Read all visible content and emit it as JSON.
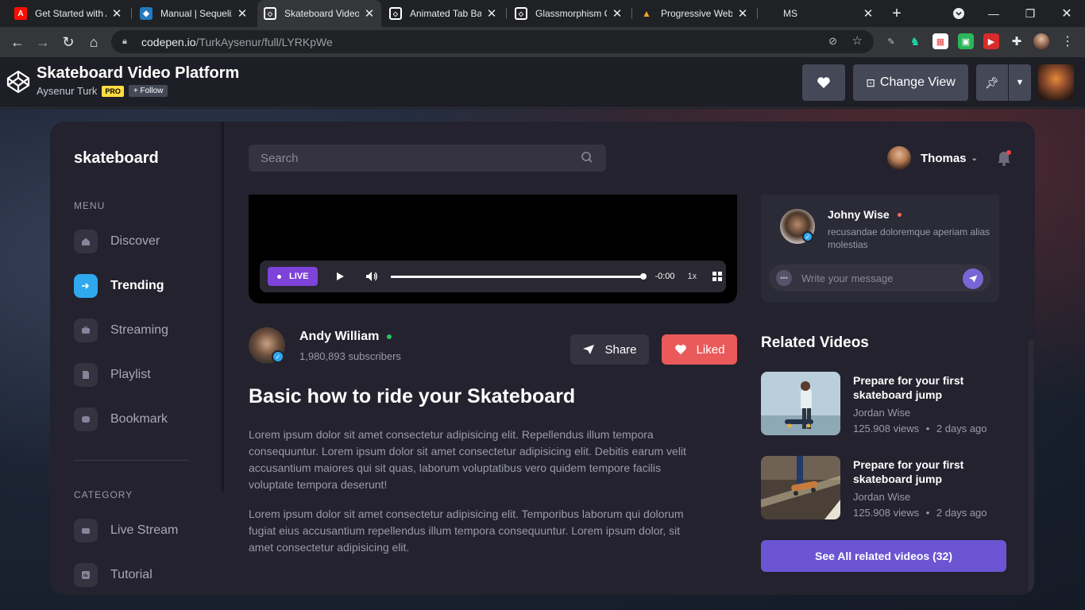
{
  "browser": {
    "tabs": [
      {
        "title": "Get Started with Adobe",
        "active": false
      },
      {
        "title": "Manual | Sequelize",
        "active": false
      },
      {
        "title": "Skateboard Video Platform",
        "active": true
      },
      {
        "title": "Animated Tab Bar",
        "active": false
      },
      {
        "title": "Glassmorphism Cards",
        "active": false
      },
      {
        "title": "Progressive Web App",
        "active": false
      },
      {
        "title": "MS",
        "active": false
      }
    ],
    "url_host": "codepen.io",
    "url_path": "/TurkAysenur/full/LYRKpWe"
  },
  "codepen": {
    "title": "Skateboard Video Platform",
    "author": "Aysenur Turk",
    "pro_label": "PRO",
    "follow_label": "+ Follow",
    "change_view_label": "Change View"
  },
  "app": {
    "brand": "skateboard",
    "menu_heading": "MENU",
    "menu": [
      {
        "label": "Discover",
        "icon": "home-icon",
        "active": false
      },
      {
        "label": "Trending",
        "icon": "trending-icon",
        "active": true
      },
      {
        "label": "Streaming",
        "icon": "streaming-icon",
        "active": false
      },
      {
        "label": "Playlist",
        "icon": "playlist-icon",
        "active": false
      },
      {
        "label": "Bookmark",
        "icon": "bookmark-icon",
        "active": false
      }
    ],
    "category_heading": "CATEGORY",
    "categories": [
      {
        "label": "Live Stream",
        "icon": "live-stream-icon"
      },
      {
        "label": "Tutorial",
        "icon": "tutorial-icon"
      }
    ],
    "search_placeholder": "Search",
    "user_name": "Thomas",
    "player": {
      "live_label": "LIVE",
      "time": "-0:00",
      "speed": "1x",
      "progress": 1.0
    },
    "channel": {
      "name": "Andy William",
      "subscribers": "1,980,893 subscribers"
    },
    "share_label": "Share",
    "liked_label": "Liked",
    "video_title": "Basic how to ride your Skateboard",
    "paragraphs": [
      "Lorem ipsum dolor sit amet consectetur adipisicing elit. Repellendus illum tempora consequuntur. Lorem ipsum dolor sit amet consectetur adipisicing elit. Debitis earum velit accusantium maiores qui sit quas, laborum voluptatibus vero quidem tempore facilis voluptate tempora deserunt!",
      "Lorem ipsum dolor sit amet consectetur adipisicing elit. Temporibus laborum qui dolorum fugiat eius accusantium repellendus illum tempora consequuntur. Lorem ipsum dolor, sit amet consectetur adipisicing elit."
    ],
    "chat": {
      "name": "Johny Wise",
      "message": "recusandae doloremque aperiam alias molestias",
      "input_placeholder": "Write your message"
    },
    "related_heading": "Related Videos",
    "related": [
      {
        "title": "Prepare for your first skateboard jump",
        "author": "Jordan Wise",
        "views": "125.908 views",
        "age": "2 days ago"
      },
      {
        "title": "Prepare for your first skateboard jump",
        "author": "Jordan Wise",
        "views": "125.908 views",
        "age": "2 days ago"
      }
    ],
    "see_all_label": "See All related videos (32)"
  },
  "colors": {
    "accent_blue": "#2ea8ef",
    "live_purple": "#7e43d9",
    "liked_red": "#ea5a5a",
    "see_all_purple": "#6c55d3",
    "panel_bg": "#23222e"
  }
}
